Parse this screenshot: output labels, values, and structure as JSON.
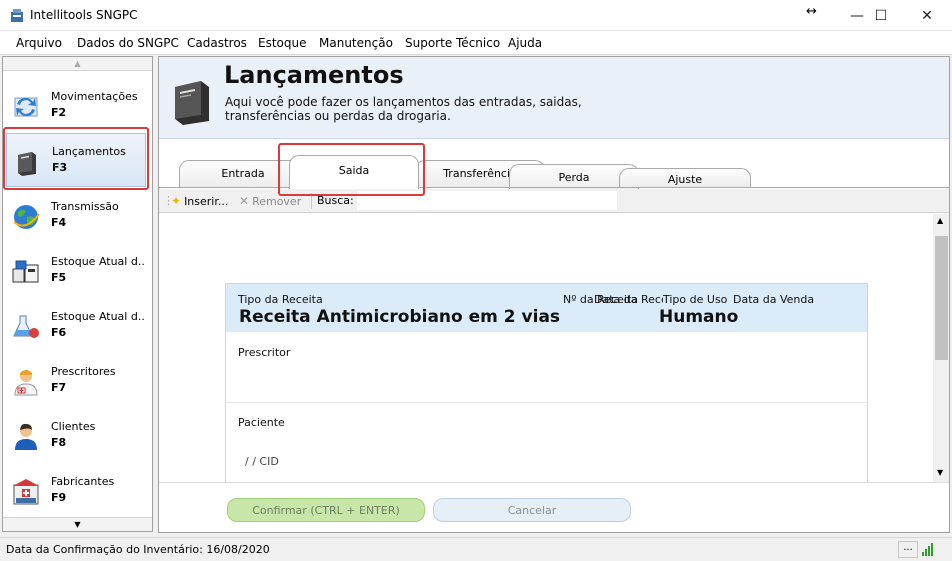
{
  "window": {
    "title": "Intellitools SNGPC",
    "minimize_symbol": "—",
    "maximize_symbol": "☐",
    "close_symbol": "✕",
    "resize_symbol": "↔"
  },
  "menu": [
    "Arquivo",
    "Dados do SNGPC",
    "Cadastros",
    "Estoque",
    "Manutenção",
    "Suporte Técnico",
    "Ajuda"
  ],
  "sidebar": {
    "items": [
      {
        "label": "Movimentações",
        "key": "F2",
        "icon": "sync-arrows-icon"
      },
      {
        "label": "Lançamentos",
        "key": "F3",
        "icon": "book-icon"
      },
      {
        "label": "Transmissão",
        "key": "F4",
        "icon": "globe-icon"
      },
      {
        "label": "Estoque Atual d...",
        "key": "F5",
        "icon": "boxes-icon"
      },
      {
        "label": "Estoque Atual d...",
        "key": "F6",
        "icon": "lab-flask-icon"
      },
      {
        "label": "Prescritores",
        "key": "F7",
        "icon": "doctor-icon"
      },
      {
        "label": "Clientes",
        "key": "F8",
        "icon": "person-icon"
      },
      {
        "label": "Fabricantes",
        "key": "F9",
        "icon": "pharmacy-icon"
      }
    ]
  },
  "header": {
    "title": "Lançamentos",
    "description": "Aqui você pode fazer os lançamentos das entradas, saidas, transferências ou perdas da drogaria."
  },
  "tabs": [
    {
      "label": "Entrada",
      "active": false
    },
    {
      "label": "Saida",
      "active": true
    },
    {
      "label": "Transferência",
      "active": false
    },
    {
      "label": "Perda",
      "active": false
    },
    {
      "label": "Ajuste",
      "active": false
    }
  ],
  "toolbar": {
    "insert_label": "Inserir...",
    "remove_label": "Remover",
    "search_label": "Busca:",
    "search_value": ""
  },
  "card": {
    "tipo_receita_label": "Tipo da Receita",
    "tipo_receita_value": "Receita Antimicrobiano em 2 vias",
    "numero_receita_label": "Nº da Receita",
    "data_receita_label": "Data da Receita",
    "tipo_uso_label": "Tipo de Uso",
    "tipo_uso_value": "Humano",
    "data_venda_label": "Data da Venda",
    "prescritor_label": "Prescritor",
    "paciente_label": "Paciente",
    "cid_text": "/  /  CID"
  },
  "buttons": {
    "confirm": "Confirmar (CTRL + ENTER)",
    "cancel": "Cancelar"
  },
  "status": {
    "text": "Data da Confirmação do Inventário: 16/08/2020",
    "more": "..."
  },
  "colors": {
    "highlight": "#d93a3a",
    "header_bg": "#eaf0f8",
    "card_head_bg": "#dcebf8",
    "confirm_bg": "#c8e6a8",
    "cancel_bg": "#e6eef6"
  }
}
